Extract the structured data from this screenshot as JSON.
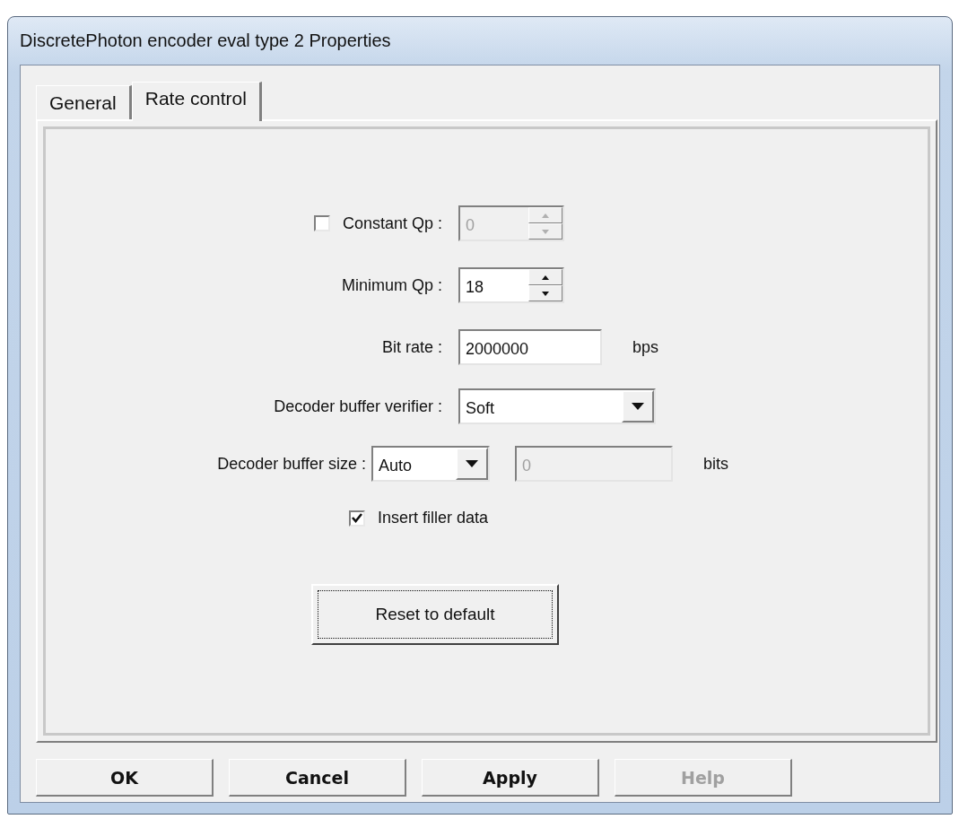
{
  "window": {
    "title": "DiscretePhoton encoder eval type 2 Properties"
  },
  "tabs": [
    {
      "label": "General",
      "selected": false
    },
    {
      "label": "Rate control",
      "selected": true
    }
  ],
  "fields": [
    {
      "kind": "spin",
      "label": "Constant Qp :",
      "checked": false,
      "value": "0",
      "disabled": true
    },
    {
      "kind": "spin",
      "label": "Minimum Qp :",
      "value": "18",
      "disabled": false
    },
    {
      "kind": "text",
      "label": "Bit rate :",
      "value": "2000000",
      "unit": "bps"
    },
    {
      "kind": "combo",
      "label": "Decoder buffer verifier :",
      "value": "Soft"
    },
    {
      "kind": "combo_text",
      "label": "Decoder buffer size :",
      "value": "Auto",
      "value_2": "0",
      "unit": "bits"
    }
  ],
  "filler": {
    "label": "Insert filler data",
    "checked": true
  },
  "reset_button": {
    "label": "Reset to default",
    "focused": true
  },
  "buttons": [
    {
      "label": "OK",
      "disabled": false
    },
    {
      "label": "Cancel",
      "disabled": false
    },
    {
      "label": "Apply",
      "disabled": false
    },
    {
      "label": "Help",
      "disabled": true
    }
  ]
}
